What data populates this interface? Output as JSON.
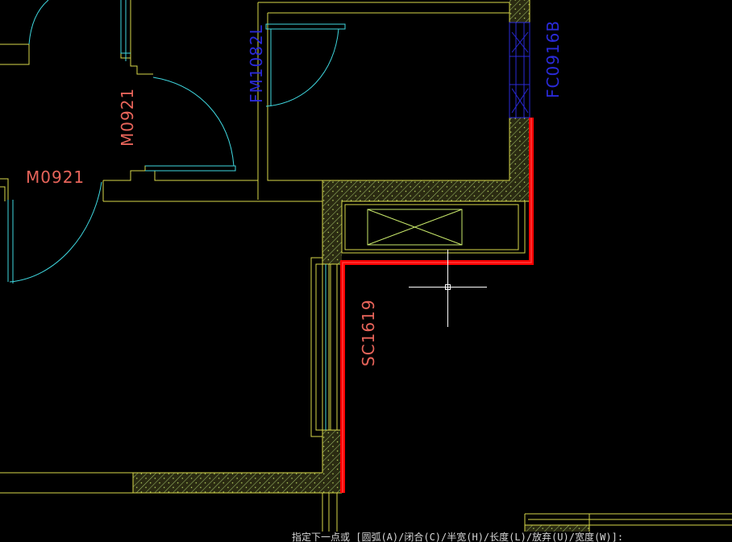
{
  "drawing": {
    "labels": {
      "door_a": "M0921",
      "door_b": "M0921",
      "fire_door": "FM1082L",
      "fire_window": "FC0916B",
      "window": "SC1619"
    },
    "colors": {
      "background": "#000000",
      "wall_line": "#d8d84a",
      "door_swing": "#3fd8e0",
      "label_red": "#e8645a",
      "label_blue": "#2a2ad8",
      "polyline_red": "#ff0000",
      "hatch_fill": "#2b2b12",
      "hatch_dots": "#9fbf6a",
      "crosshair": "#ffffff",
      "equipment": "#c8e86a"
    },
    "icons": {
      "cursor": "crosshair-cursor-icon",
      "equipment": "x-box-equipment-icon"
    }
  },
  "command_line": {
    "prompt": "指定下一点或 [圆弧(A)/闭合(C)/半宽(H)/长度(L)/放弃(U)/宽度(W)]:"
  }
}
